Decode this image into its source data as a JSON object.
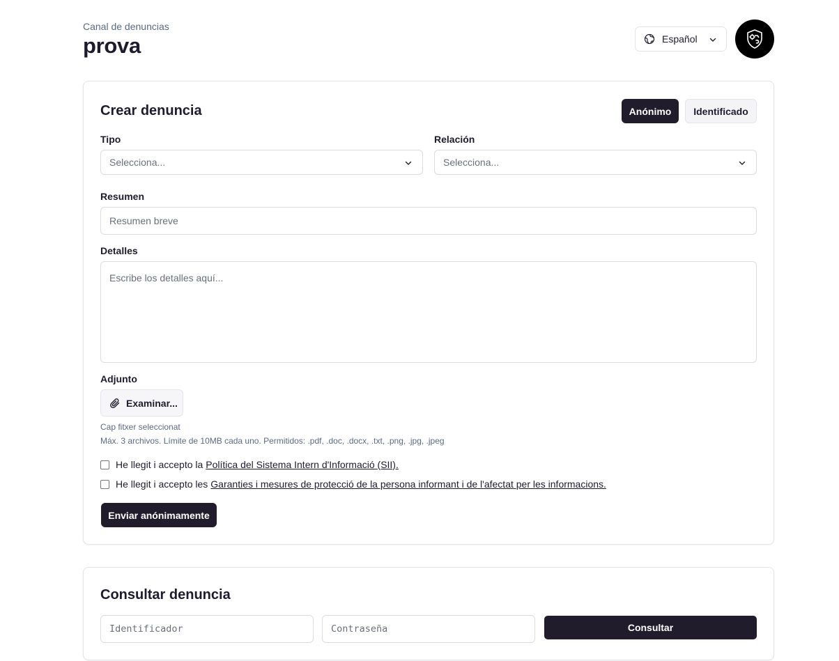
{
  "header": {
    "subtitle": "Canal de denuncias",
    "title": "prova",
    "language": "Español",
    "language_icon": "globe-icon",
    "logo_icon": "shield-gear-icon"
  },
  "create": {
    "title": "Crear denuncia",
    "mode_anonymous": "Anónimo",
    "mode_identified": "Identificado",
    "tipo_label": "Tipo",
    "tipo_placeholder": "Selecciona...",
    "relacion_label": "Relación",
    "relacion_placeholder": "Selecciona...",
    "resumen_label": "Resumen",
    "resumen_placeholder": "Resumen breve",
    "detalles_label": "Detalles",
    "detalles_placeholder": "Escribe los detalles aquí...",
    "adjunto_label": "Adjunto",
    "examinar_label": "Examinar...",
    "no_file": "Cap fitxer seleccionat",
    "file_limits": "Máx. 3 archivos. Límite de 10MB cada uno. Permitidos: .pdf, .doc, .docx, .txt, .png, .jpg, .jpeg",
    "check1_prefix": "He llegit i accepto la",
    "check1_link": "Política del Sistema Intern d'Informació (SII).",
    "check2_prefix": "He llegit i accepto les",
    "check2_link": "Garanties i mesures de protecció de la persona informant i de l'afectat per les informacions.",
    "submit_label": "Enviar anónimamente"
  },
  "consult": {
    "title": "Consultar denuncia",
    "id_placeholder": "Identificador",
    "password_placeholder": "Contraseña",
    "button_label": "Consultar"
  },
  "colors": {
    "primary": "#201c2c",
    "muted_text": "#5b6a82",
    "border": "#d9dce3"
  }
}
